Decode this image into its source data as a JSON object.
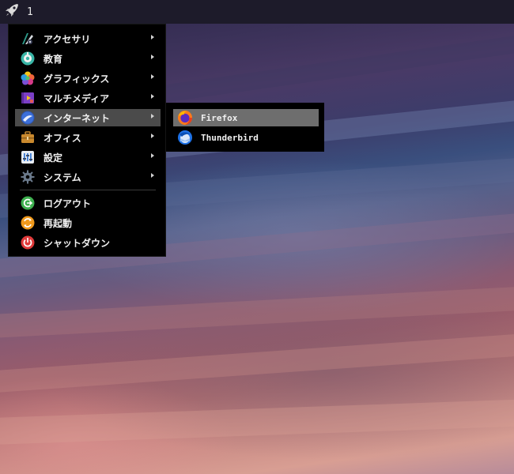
{
  "taskbar": {
    "launcher_icon": "rocket-icon",
    "workspace_label": "1"
  },
  "menu": {
    "items": [
      {
        "label": "アクセサリ",
        "icon": "accessories-icon",
        "has_submenu": true
      },
      {
        "label": "教育",
        "icon": "education-icon",
        "has_submenu": true
      },
      {
        "label": "グラフィックス",
        "icon": "graphics-icon",
        "has_submenu": true
      },
      {
        "label": "マルチメディア",
        "icon": "multimedia-icon",
        "has_submenu": true
      },
      {
        "label": "インターネット",
        "icon": "internet-icon",
        "has_submenu": true,
        "selected": true
      },
      {
        "label": "オフィス",
        "icon": "office-icon",
        "has_submenu": true
      },
      {
        "label": "設定",
        "icon": "settings-icon",
        "has_submenu": true
      },
      {
        "label": "システム",
        "icon": "system-gear-icon",
        "has_submenu": true
      }
    ],
    "session_items": [
      {
        "label": "ログアウト",
        "icon": "logout-icon"
      },
      {
        "label": "再起動",
        "icon": "reboot-icon"
      },
      {
        "label": "シャットダウン",
        "icon": "shutdown-icon"
      }
    ]
  },
  "submenu": {
    "items": [
      {
        "label": "Firefox",
        "icon": "firefox-icon",
        "selected": true
      },
      {
        "label": "Thunderbird",
        "icon": "thunderbird-icon"
      }
    ]
  },
  "colors": {
    "menu_bg": "#000000",
    "highlight": "#4b4b4b",
    "sub_highlight": "#6e6e6e",
    "taskbar_bg": "#1d1b2a"
  }
}
